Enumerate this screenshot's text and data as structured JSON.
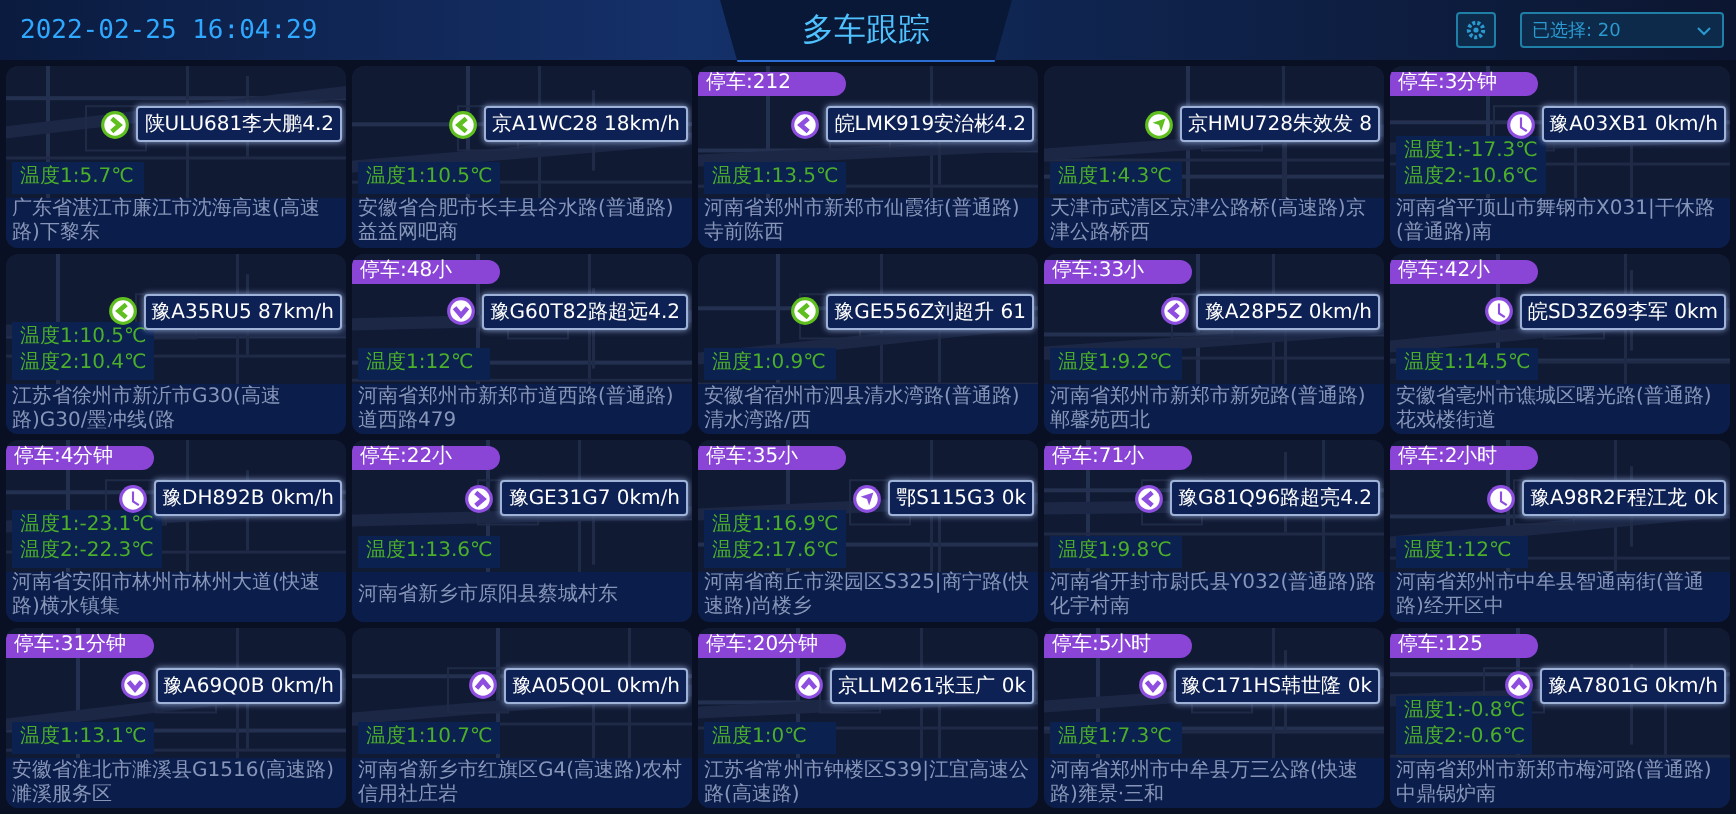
{
  "header": {
    "datetime": "2022-02-25 16:04:29",
    "title": "多车跟踪",
    "select": {
      "value": "已选择: 20"
    }
  },
  "cards": [
    {
      "temps": [
        "温度1:5.7℃"
      ],
      "plate": "陕ULU681李大鹏4.2",
      "kind": "right",
      "moving": true,
      "address": "广东省湛江市廉江市沈海高速(高速路)下黎东"
    },
    {
      "temps": [
        "温度1:10.5℃"
      ],
      "plate": "京A1WC28 18km/h",
      "kind": "left",
      "moving": true,
      "address": "安徽省合肥市长丰县谷水路(普通路)益益网吧商"
    },
    {
      "stop": "停车:212",
      "temps": [
        "温度1:13.5℃"
      ],
      "plate": "皖LMK919安治彬4.2",
      "kind": "left",
      "moving": false,
      "address": "河南省郑州市新郑市仙霞街(普通路)寺前陈西"
    },
    {
      "temps": [
        "温度1:4.3℃"
      ],
      "plate": "京HMU728朱效发 8",
      "kind": "nav",
      "moving": true,
      "address": "天津市武清区京津公路桥(高速路)京津公路桥西"
    },
    {
      "stop": "停车:3分钟",
      "temps": [
        "温度1:-17.3℃",
        "温度2:-10.6℃"
      ],
      "plate": "豫A03XB1 0km/h",
      "kind": "stop",
      "moving": false,
      "address": "河南省平顶山市舞钢市X031|干休路(普通路)南"
    },
    {
      "temps": [
        "温度1:10.5℃",
        "温度2:10.4℃"
      ],
      "plate": "豫A35RU5 87km/h",
      "kind": "left",
      "moving": true,
      "address": "江苏省徐州市新沂市G30(高速路)G30/墨冲线(路"
    },
    {
      "stop": "停车:48小",
      "temps": [
        "温度1:12℃"
      ],
      "plate": "豫G60T82路超远4.2",
      "kind": "down",
      "moving": false,
      "address": "河南省郑州市新郑市道西路(普通路)道西路479"
    },
    {
      "temps": [
        "温度1:0.9℃"
      ],
      "plate": "豫GE556Z刘超升 61",
      "kind": "left",
      "moving": true,
      "address": "安徽省宿州市泗县清水湾路(普通路)清水湾路/西"
    },
    {
      "stop": "停车:33小",
      "temps": [
        "温度1:9.2℃"
      ],
      "plate": "豫A28P5Z 0km/h",
      "kind": "left",
      "moving": false,
      "address": "河南省郑州市新郑市新宛路(普通路)郸馨苑西北"
    },
    {
      "stop": "停车:42小",
      "temps": [
        "温度1:14.5℃"
      ],
      "plate": "皖SD3Z69李军 0km",
      "kind": "stop",
      "moving": false,
      "address": "安徽省亳州市谯城区曙光路(普通路)花戏楼街道"
    },
    {
      "stop": "停车:4分钟",
      "temps": [
        "温度1:-23.1℃",
        "温度2:-22.3℃"
      ],
      "plate": "豫DH892B 0km/h",
      "kind": "stop",
      "moving": false,
      "address": "河南省安阳市林州市林州大道(快速路)横水镇集"
    },
    {
      "stop": "停车:22小",
      "temps": [
        "温度1:13.6℃"
      ],
      "plate": "豫GE31G7 0km/h",
      "kind": "right",
      "moving": false,
      "address": "河南省新乡市原阳县蔡城村东"
    },
    {
      "stop": "停车:35小",
      "temps": [
        "温度1:16.9℃",
        "温度2:17.6℃"
      ],
      "plate": "鄂S115G3 0k",
      "kind": "nav",
      "moving": false,
      "address": "河南省商丘市梁园区S325|商宁路(快速路)尚楼乡"
    },
    {
      "stop": "停车:71小",
      "temps": [
        "温度1:9.8℃"
      ],
      "plate": "豫G81Q96路超亮4.2",
      "kind": "left",
      "moving": false,
      "address": "河南省开封市尉氏县Y032(普通路)路化宇村南"
    },
    {
      "stop": "停车:2小时",
      "temps": [
        "温度1:12℃"
      ],
      "plate": "豫A98R2F程江龙 0k",
      "kind": "stop",
      "moving": false,
      "address": "河南省郑州市中牟县智通南街(普通路)经开区中"
    },
    {
      "stop": "停车:31分钟",
      "temps": [
        "温度1:13.1℃"
      ],
      "plate": "豫A69Q0B 0km/h",
      "kind": "down",
      "moving": false,
      "address": "安徽省淮北市濉溪县G1516(高速路)濉溪服务区"
    },
    {
      "temps": [
        "温度1:10.7℃"
      ],
      "plate": "豫A05Q0L 0km/h",
      "kind": "up",
      "moving": false,
      "address": "河南省新乡市红旗区G4(高速路)农村信用社庄岩"
    },
    {
      "stop": "停车:20分钟",
      "temps": [
        "温度1:0℃"
      ],
      "plate": "京LLM261张玉广 0k",
      "kind": "up",
      "moving": false,
      "address": "江苏省常州市钟楼区S39|江宜高速公路(高速路)"
    },
    {
      "stop": "停车:5小时",
      "temps": [
        "温度1:7.3℃"
      ],
      "plate": "豫C171HS韩世隆 0k",
      "kind": "down",
      "moving": false,
      "address": "河南省郑州市中牟县万三公路(快速路)雍景·三和"
    },
    {
      "stop": "停车:125",
      "temps": [
        "温度1:-0.8℃",
        "温度2:-0.6℃"
      ],
      "plate": "豫A7801G 0km/h",
      "kind": "up",
      "moving": false,
      "address": "河南省郑州市新郑市梅河路(普通路)中鼎锅炉南"
    }
  ]
}
